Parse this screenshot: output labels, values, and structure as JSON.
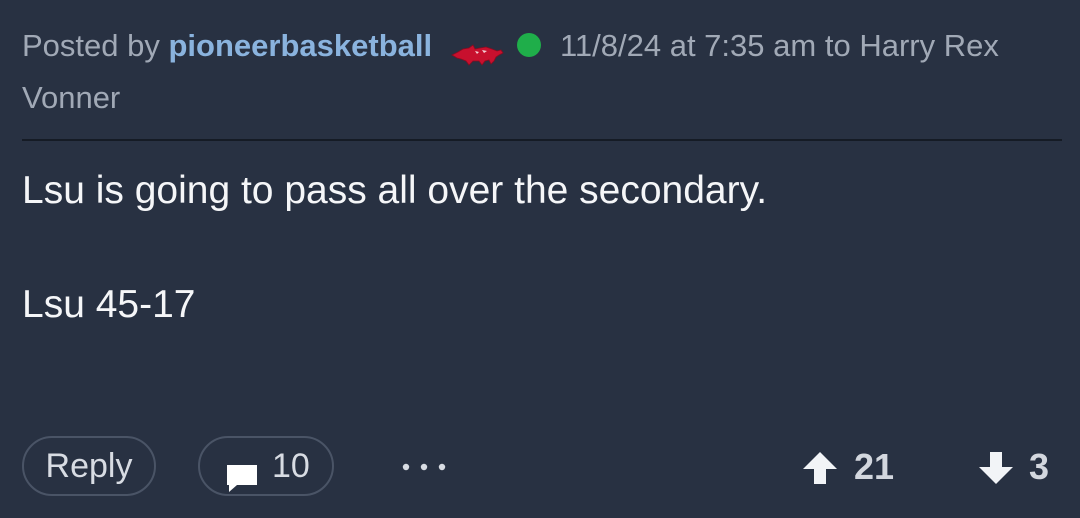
{
  "post": {
    "posted_by_prefix": "Posted by",
    "username": "pioneerbasketball",
    "team_icon": "razorback-hog-icon",
    "online_status": "online",
    "timestamp": "11/8/24 at 7:35 am",
    "to_prefix": "to",
    "reply_to": "Harry Rex Vonner",
    "body_lines": [
      "Lsu is going to pass all over the secondary.",
      "Lsu 45-17"
    ]
  },
  "actions": {
    "reply_label": "Reply",
    "comment_count": "10",
    "more_icon": "ellipsis-icon",
    "upvotes": "21",
    "downvotes": "3"
  },
  "colors": {
    "background": "#283142",
    "username": "#8ab3de",
    "online": "#1fae4a",
    "team_red": "#c8102e",
    "meta_text": "#a1a9b6"
  }
}
